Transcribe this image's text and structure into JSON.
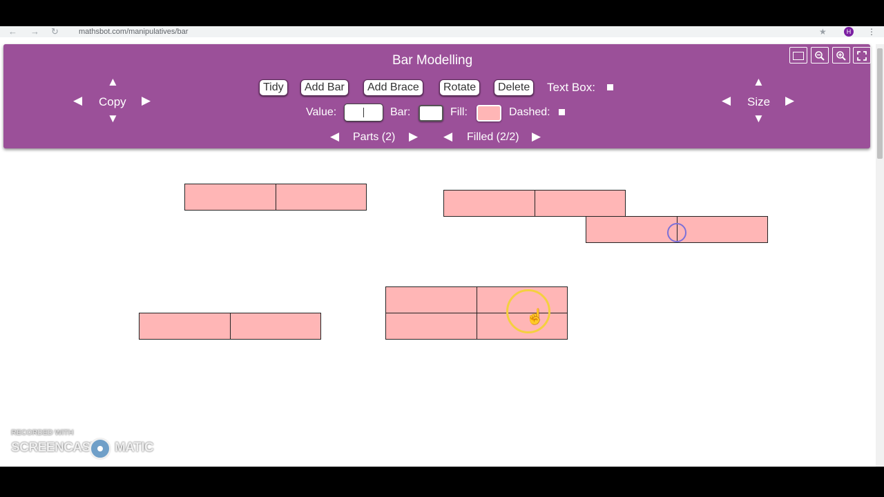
{
  "browser": {
    "url": "mathsbot.com/manipulatives/bar",
    "profile_initial": "H"
  },
  "app": {
    "title": "Bar Modelling"
  },
  "toolbar": {
    "copy_label": "Copy",
    "size_label": "Size",
    "buttons": [
      "Tidy",
      "Add Bar",
      "Add Brace",
      "Rotate",
      "Delete"
    ],
    "text_box_label": "Text Box:",
    "value_label": "Value:",
    "value_input": "",
    "bar_label": "Bar:",
    "fill_label": "Fill:",
    "dashed_label": "Dashed:",
    "parts_label": "Parts (2)",
    "filled_label": "Filled (2/2)",
    "colors": {
      "toolbar": "#9b5099",
      "fill": "#ffb6b6",
      "bar": "#ffffff"
    }
  },
  "canvas": {
    "bars": [
      {
        "id": "bar-1",
        "parts": 2,
        "filled": 2
      },
      {
        "id": "bar-2",
        "parts": 2,
        "filled": 2
      },
      {
        "id": "bar-3",
        "parts": 2,
        "filled": 2
      },
      {
        "id": "bar-4",
        "parts": 2,
        "filled": 2
      },
      {
        "id": "bar-5",
        "parts": 2,
        "filled": 2
      },
      {
        "id": "bar-6",
        "parts": 2,
        "filled": 2
      }
    ]
  },
  "watermark": {
    "top": "RECORDED WITH",
    "main": "SCREENCAST",
    "end": "MATIC"
  }
}
